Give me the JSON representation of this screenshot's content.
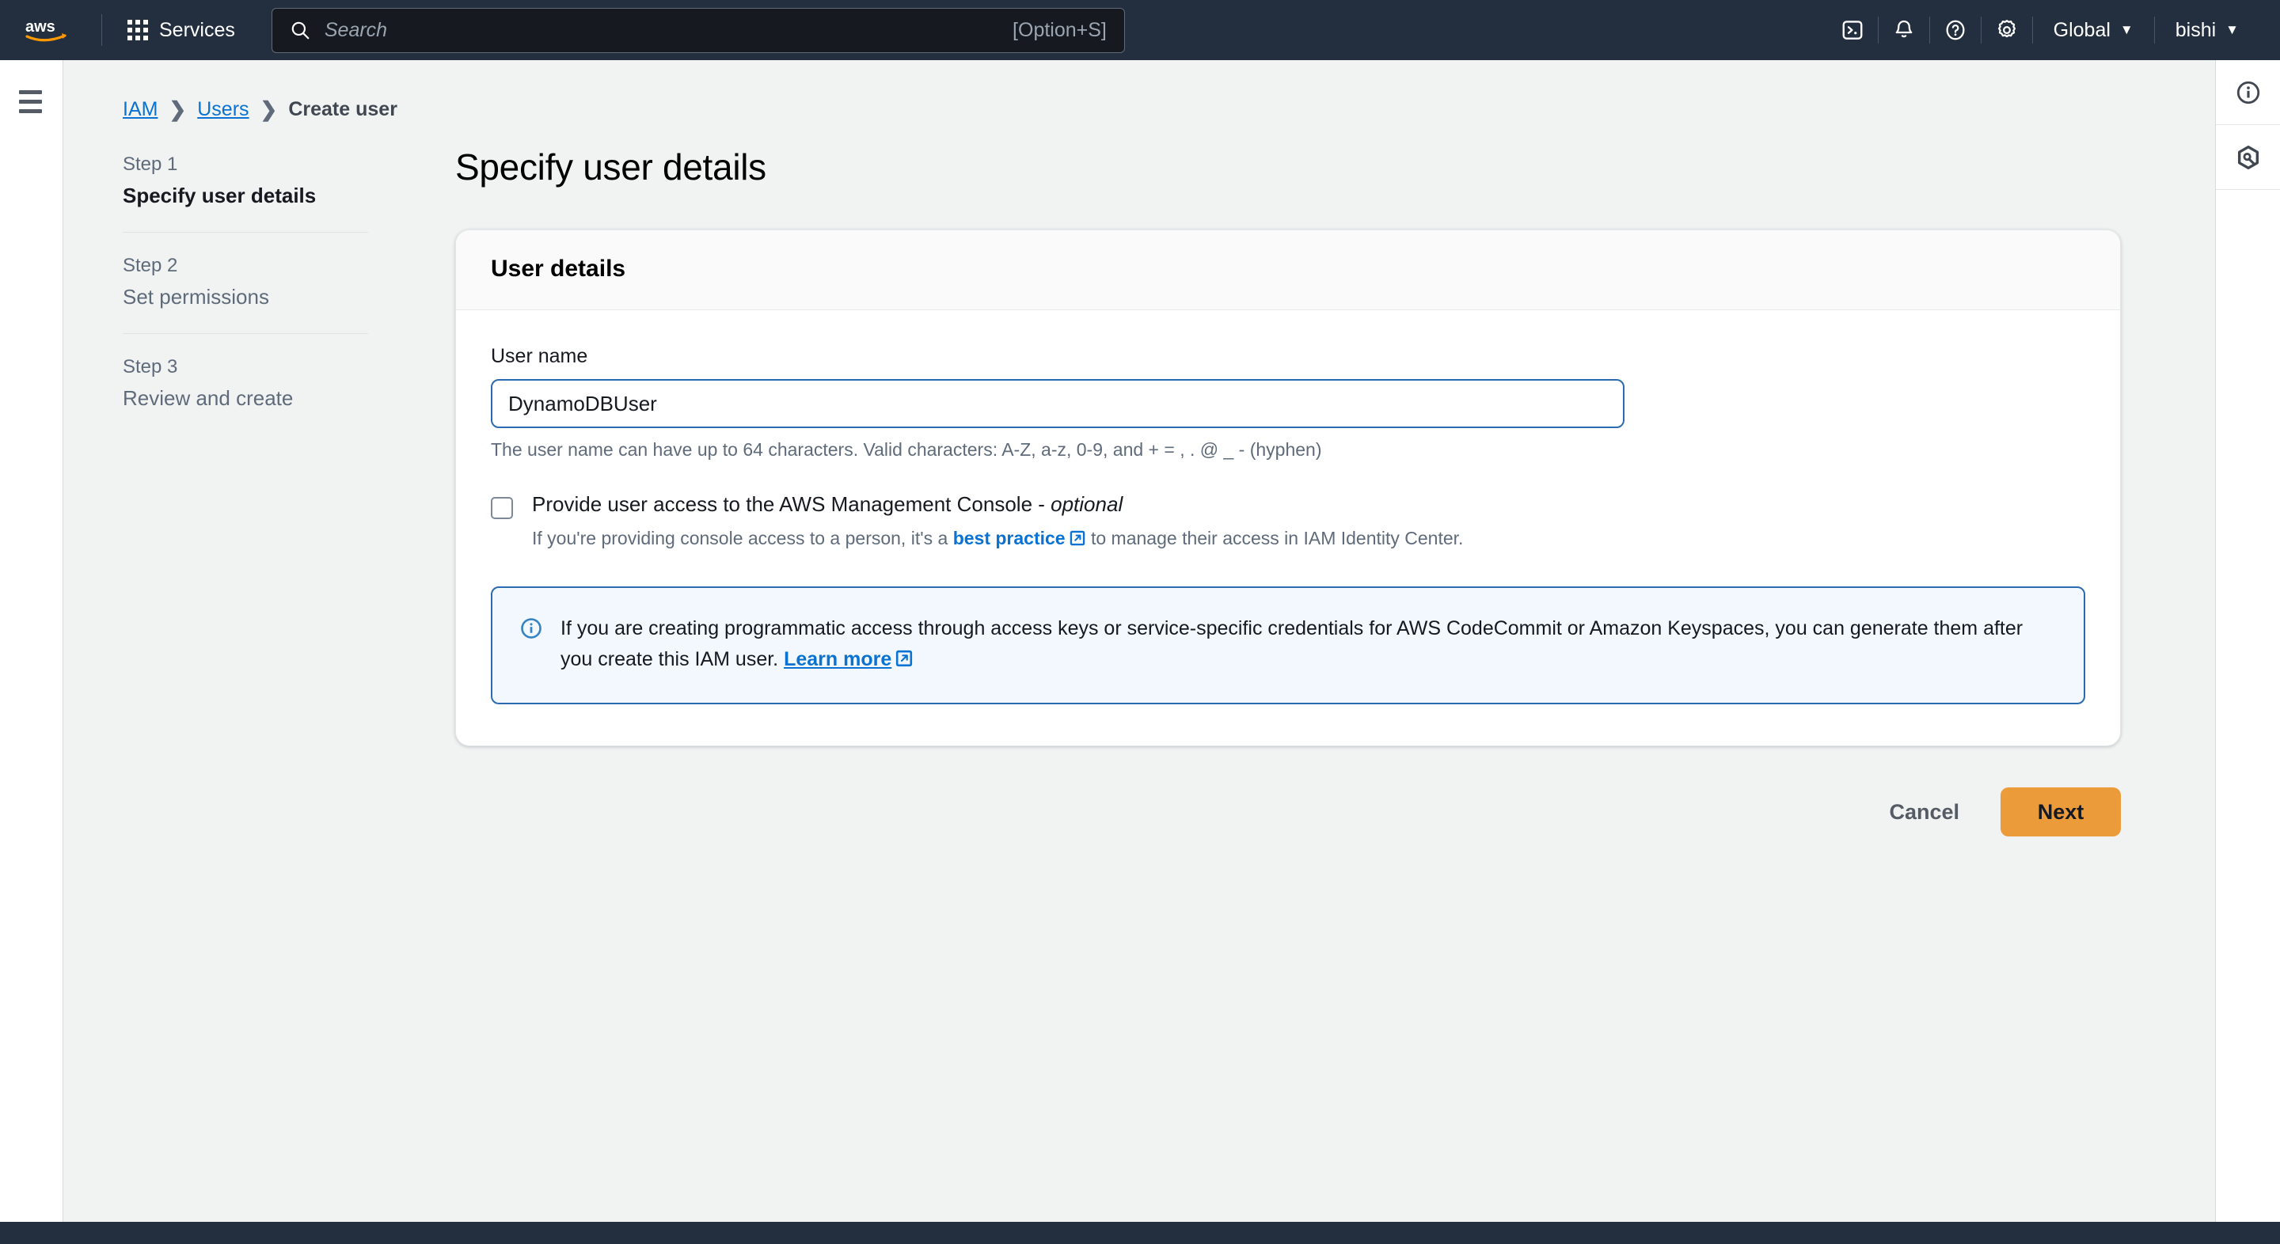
{
  "topnav": {
    "logo_alt": "aws",
    "services_label": "Services",
    "search_placeholder": "Search",
    "search_shortcut": "[Option+S]",
    "region_label": "Global",
    "account_label": "bishi",
    "caret": "▼",
    "icons": [
      "cloudshell-icon",
      "bell-icon",
      "help-icon",
      "settings-icon"
    ]
  },
  "breadcrumb": {
    "items": [
      {
        "label": "IAM",
        "link": true
      },
      {
        "label": "Users",
        "link": true
      },
      {
        "label": "Create user",
        "link": false
      }
    ],
    "separator": "❯"
  },
  "steps": [
    {
      "num": "Step 1",
      "title": "Specify user details",
      "active": true
    },
    {
      "num": "Step 2",
      "title": "Set permissions",
      "active": false
    },
    {
      "num": "Step 3",
      "title": "Review and create",
      "active": false
    }
  ],
  "page": {
    "title": "Specify user details"
  },
  "card": {
    "heading": "User details",
    "username_label": "User name",
    "username_value": "DynamoDBUser",
    "username_hint": "The user name can have up to 64 characters. Valid characters: A-Z, a-z, 0-9, and + = , . @ _ - (hyphen)",
    "console_checkbox_label_main": "Provide user access to the AWS Management Console - ",
    "console_checkbox_label_em": "optional",
    "console_checkbox_checked": false,
    "console_desc_pre": "If you're providing console access to a person, it's a ",
    "console_desc_link": "best practice",
    "console_desc_post": " to manage their access in IAM Identity Center.",
    "alert_text_pre": "If you are creating programmatic access through access keys or service-specific credentials for AWS CodeCommit or Amazon Keyspaces, you can generate them after you create this IAM user. ",
    "alert_link": "Learn more"
  },
  "actions": {
    "cancel_label": "Cancel",
    "next_label": "Next"
  },
  "rightrail": {
    "icons": [
      "info-icon",
      "shortcuts-icon"
    ]
  },
  "colors": {
    "nav_bg": "#232f3e",
    "page_bg": "#f1f3f3",
    "link": "#0972d3",
    "accent_button": "#ec9b3b",
    "input_focus_border": "#2b6cb0",
    "alert_bg": "#f2f8fd"
  }
}
